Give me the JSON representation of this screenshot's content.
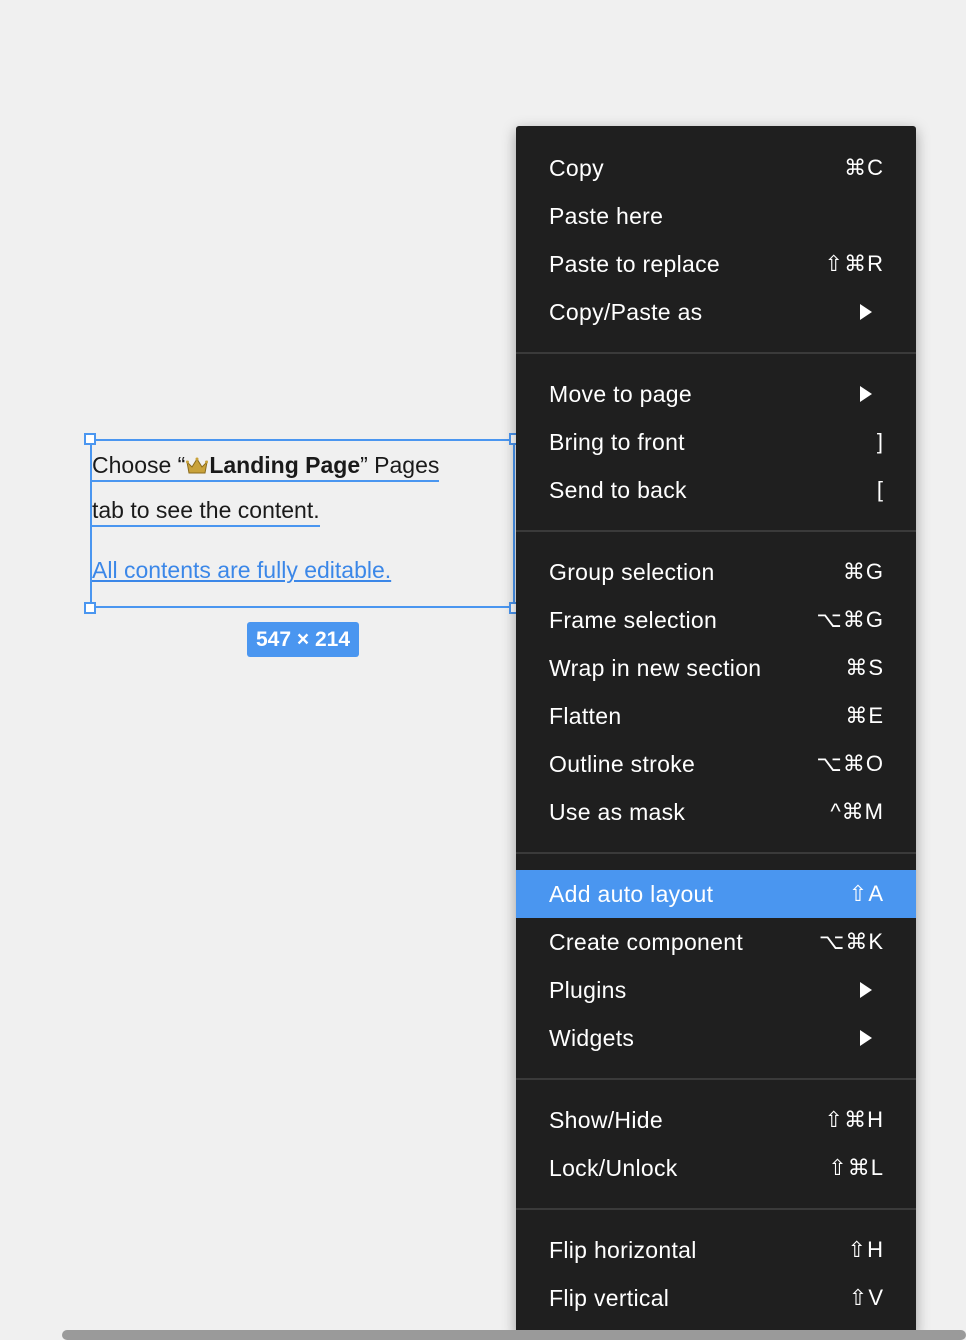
{
  "selection": {
    "line1_before": "Choose “",
    "line1_bold": "Landing Page",
    "line1_after": "” Pages",
    "line2": "tab to see the content.",
    "line3": "All contents are fully editable.",
    "size_label": "547 × 214",
    "crown_icon": "crown-icon"
  },
  "menu": {
    "groups": [
      [
        {
          "label": "Copy",
          "shortcut": "⌘C"
        },
        {
          "label": "Paste here",
          "shortcut": ""
        },
        {
          "label": "Paste to replace",
          "shortcut": "⇧⌘R"
        },
        {
          "label": "Copy/Paste as",
          "submenu": true
        }
      ],
      [
        {
          "label": "Move to page",
          "submenu": true
        },
        {
          "label": "Bring to front",
          "shortcut": "]"
        },
        {
          "label": "Send to back",
          "shortcut": "["
        }
      ],
      [
        {
          "label": "Group selection",
          "shortcut": "⌘G"
        },
        {
          "label": "Frame selection",
          "shortcut": "⌥⌘G"
        },
        {
          "label": "Wrap in new section",
          "shortcut": "⌘S"
        },
        {
          "label": "Flatten",
          "shortcut": "⌘E"
        },
        {
          "label": "Outline stroke",
          "shortcut": "⌥⌘O"
        },
        {
          "label": "Use as mask",
          "shortcut": "^⌘M"
        }
      ],
      [
        {
          "label": "Add auto layout",
          "shortcut": "⇧A",
          "highlighted": true
        },
        {
          "label": "Create component",
          "shortcut": "⌥⌘K"
        },
        {
          "label": "Plugins",
          "submenu": true
        },
        {
          "label": "Widgets",
          "submenu": true
        }
      ],
      [
        {
          "label": "Show/Hide",
          "shortcut": "⇧⌘H"
        },
        {
          "label": "Lock/Unlock",
          "shortcut": "⇧⌘L"
        }
      ],
      [
        {
          "label": "Flip horizontal",
          "shortcut": "⇧H"
        },
        {
          "label": "Flip vertical",
          "shortcut": "⇧V"
        }
      ]
    ]
  },
  "colors": {
    "canvas_bg": "#f0f0f0",
    "menu_bg": "#1f1f1f",
    "highlight": "#4a96f0",
    "selection": "#4a96f0"
  }
}
